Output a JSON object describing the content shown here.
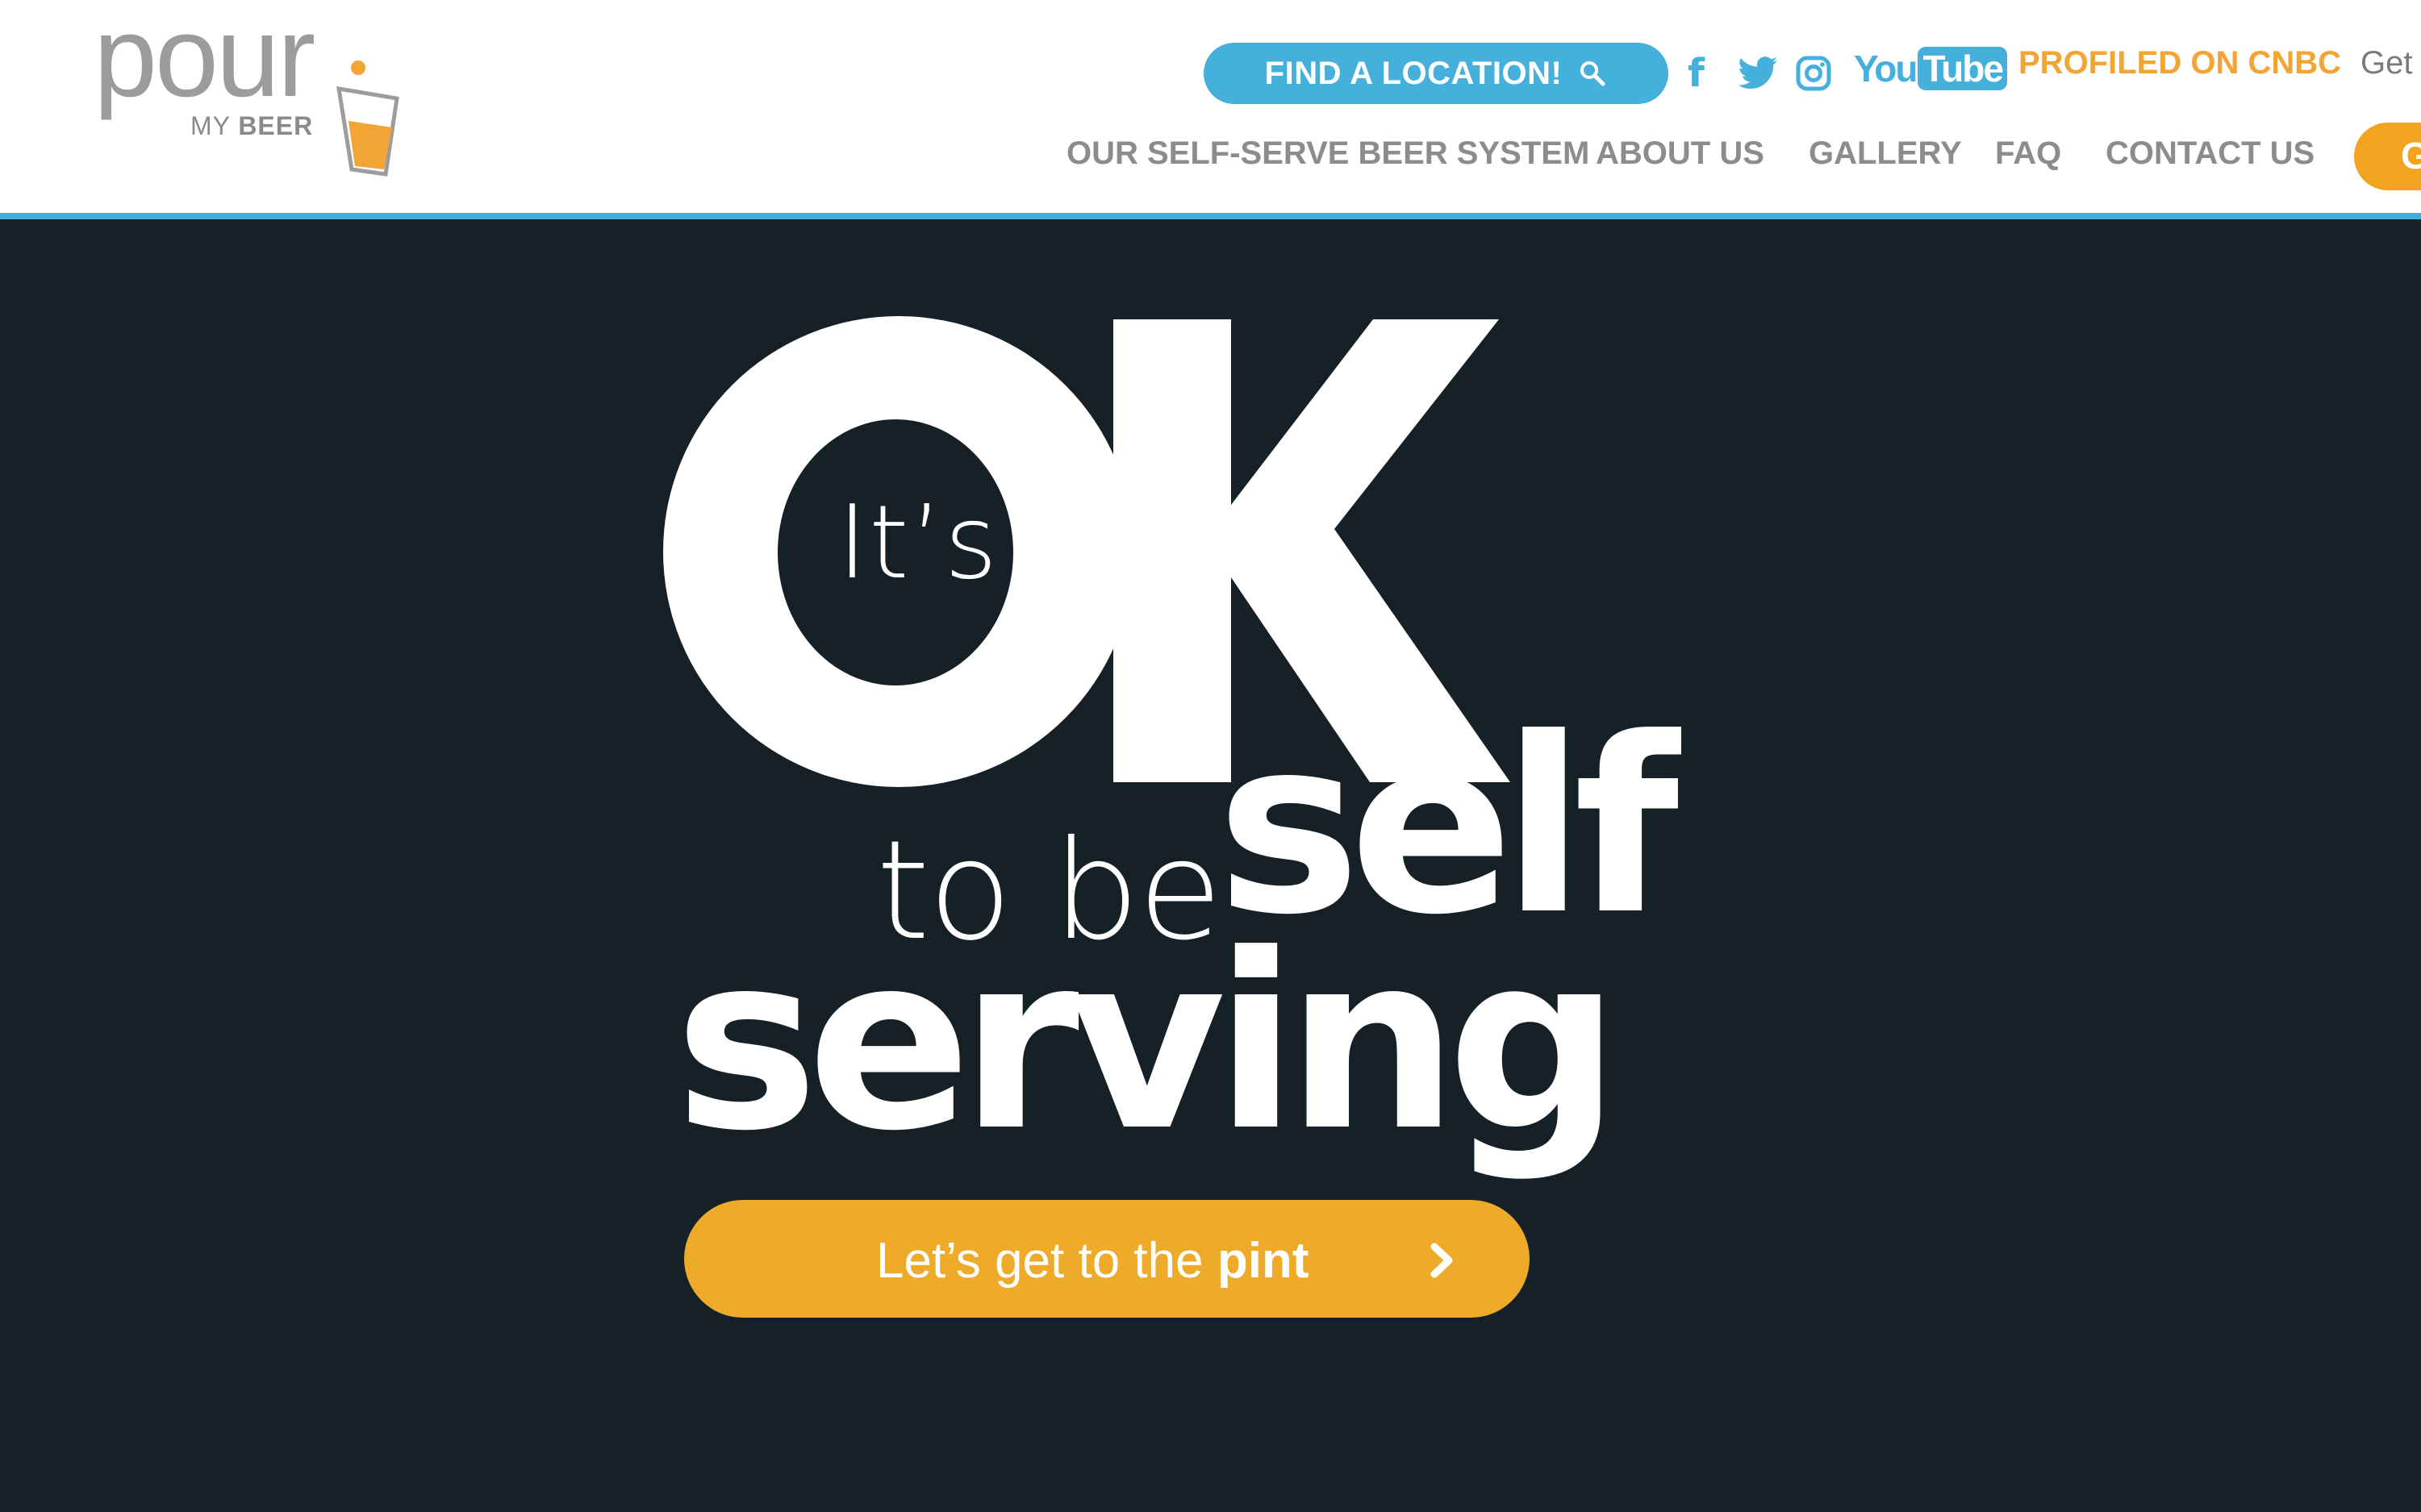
{
  "logo": {
    "word": "pour",
    "sub_prefix": "MY ",
    "sub_bold": "BEER"
  },
  "header": {
    "find_location": "FIND A LOCATION!",
    "social": {
      "facebook": "f",
      "youtube_you": "You",
      "youtube_tube": "Tube"
    },
    "cnbc": "PROFILED ON CNBC",
    "get": "Get",
    "cutoff_button": "G"
  },
  "nav": [
    "OUR SELF-SERVE BEER SYSTEM",
    "ABOUT US",
    "GALLERY",
    "FAQ",
    "CONTACT US"
  ],
  "hero": {
    "its": "It’s",
    "to_be": "to be",
    "self": "self",
    "serving": "serving",
    "cta": {
      "light": "Let’s get to the ",
      "bold": "pint"
    }
  },
  "colors": {
    "accent_blue": "#45b0dc",
    "accent_orange": "#f2a534",
    "hero_bg": "#162127",
    "cta": "#eeab29"
  },
  "icons": [
    "logo-glass-icon",
    "search-icon",
    "facebook-icon",
    "twitter-icon",
    "instagram-icon",
    "youtube-icon",
    "chevron-right-icon"
  ]
}
